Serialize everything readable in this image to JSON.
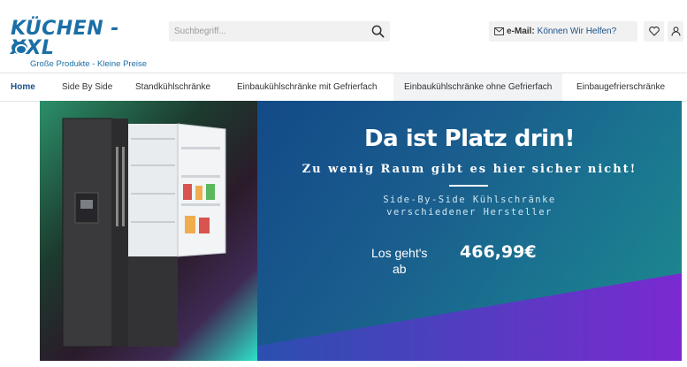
{
  "header": {
    "logo_main": "KÜCHEN - XXL",
    "logo_tagline": "Große Produkte - Kleine Preise",
    "search_placeholder": "Suchbegriff...",
    "contact_label": "e-Mail:",
    "contact_text": "Können Wir Helfen?",
    "wishlist_icon": "heart-icon",
    "account_icon": "user-icon"
  },
  "nav": {
    "items": [
      {
        "label": "Home"
      },
      {
        "label": "Side By Side"
      },
      {
        "label": "Standkühlschränke"
      },
      {
        "label": "Einbaukühlschränke mit Gefrierfach"
      },
      {
        "label": "Einbaukühlschränke ohne Gefrierfach"
      },
      {
        "label": "Einbaugefrierschränke"
      }
    ]
  },
  "banner": {
    "headline": "Da ist Platz drin!",
    "subline": "Zu wenig Raum gibt es hier sicher nicht!",
    "subtext_line1": "Side-By-Side Kühlschränke",
    "subtext_line2": "verschiedener Hersteller",
    "cta_prefix_line1": "Los geht's",
    "cta_prefix_line2": "ab",
    "price": "466,99€"
  },
  "colors": {
    "brand": "#1b6fa6",
    "nav_link": "#1b4f8a",
    "banner_blue": "#134a88",
    "banner_teal": "#1e8c8c",
    "banner_purple": "#7a2ad0"
  }
}
